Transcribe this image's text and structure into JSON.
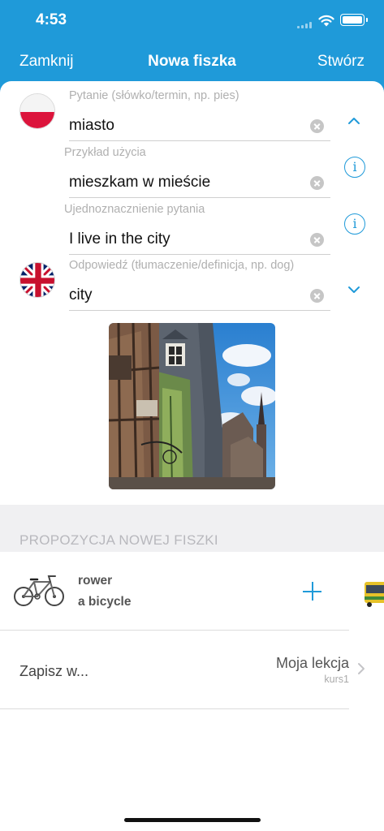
{
  "status_bar": {
    "time": "4:53"
  },
  "nav": {
    "close_label": "Zamknij",
    "title": "Nowa fiszka",
    "create_label": "Stwórz"
  },
  "colors": {
    "accent": "#1f9ad9",
    "label_gray": "#b0b0b0"
  },
  "form": {
    "question": {
      "label": "Pytanie (słówko/termin, np. pies)",
      "value": "miasto",
      "flag": "poland-flag-icon"
    },
    "example": {
      "label": "Przykład użycia",
      "value": "mieszkam w mieście"
    },
    "disambiguation": {
      "label": "Ujednoznacznienie pytania",
      "value": "I live in the city"
    },
    "answer": {
      "label": "Odpowiedź (tłumaczenie/definicja, np. dog)",
      "value": "city",
      "flag": "uk-flag-icon"
    }
  },
  "image": {
    "icon": "city-photo"
  },
  "suggestions": {
    "header": "PROPOZYCJA NOWEJ FISZKI",
    "items": [
      {
        "word": "rower",
        "translation": "a bicycle",
        "icon": "bicycle-icon"
      }
    ],
    "next_icon": "bus-icon"
  },
  "save": {
    "label": "Zapisz w...",
    "lesson": "Moja lekcja",
    "course": "kurs1"
  }
}
